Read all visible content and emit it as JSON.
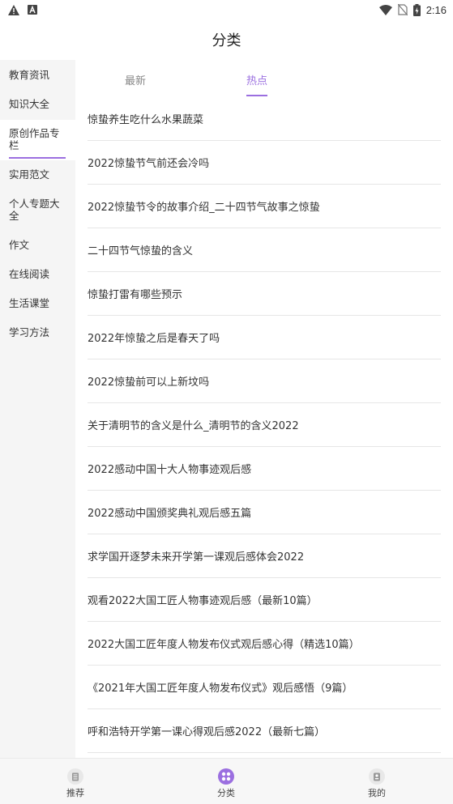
{
  "status_bar": {
    "time": "2:16",
    "icons": [
      "warning-icon",
      "a-icon",
      "wifi-icon",
      "no-sim-icon",
      "battery-icon"
    ]
  },
  "page_title": "分类",
  "sidebar": {
    "items": [
      {
        "label": "教育资讯"
      },
      {
        "label": "知识大全"
      },
      {
        "label": "原创作品专栏",
        "active": true
      },
      {
        "label": "实用范文"
      },
      {
        "label": "个人专题大全"
      },
      {
        "label": "作文"
      },
      {
        "label": "在线阅读"
      },
      {
        "label": "生活课堂"
      },
      {
        "label": "学习方法"
      }
    ]
  },
  "tabs": [
    {
      "label": "最新"
    },
    {
      "label": "热点",
      "active": true
    }
  ],
  "articles": [
    "惊蛰养生吃什么水果蔬菜",
    "2022惊蛰节气前还会冷吗",
    "2022惊蛰节令的故事介绍_二十四节气故事之惊蛰",
    "二十四节气惊蛰的含义",
    "惊蛰打雷有哪些预示",
    "2022年惊蛰之后是春天了吗",
    "2022惊蛰前可以上新坟吗",
    "关于清明节的含义是什么_清明节的含义2022",
    "2022感动中国十大人物事迹观后感",
    "2022感动中国颁奖典礼观后感五篇",
    "求学国开逐梦未来开学第一课观后感体会2022",
    "观看2022大国工匠人物事迹观后感（最新10篇）",
    "2022大国工匠年度人物发布仪式观后感心得（精选10篇）",
    "《2021年大国工匠年度人物发布仪式》观后感悟（9篇）",
    "呼和浩特开学第一课心得观后感2022（最新七篇）"
  ],
  "bottom_nav": [
    {
      "label": "推荐",
      "icon": "recommend-icon"
    },
    {
      "label": "分类",
      "icon": "category-icon",
      "active": true
    },
    {
      "label": "我的",
      "icon": "profile-icon"
    }
  ],
  "colors": {
    "accent": "#9b6fe0",
    "sidebar_bg": "#f5f5f5",
    "divider": "#e6e6e6"
  }
}
